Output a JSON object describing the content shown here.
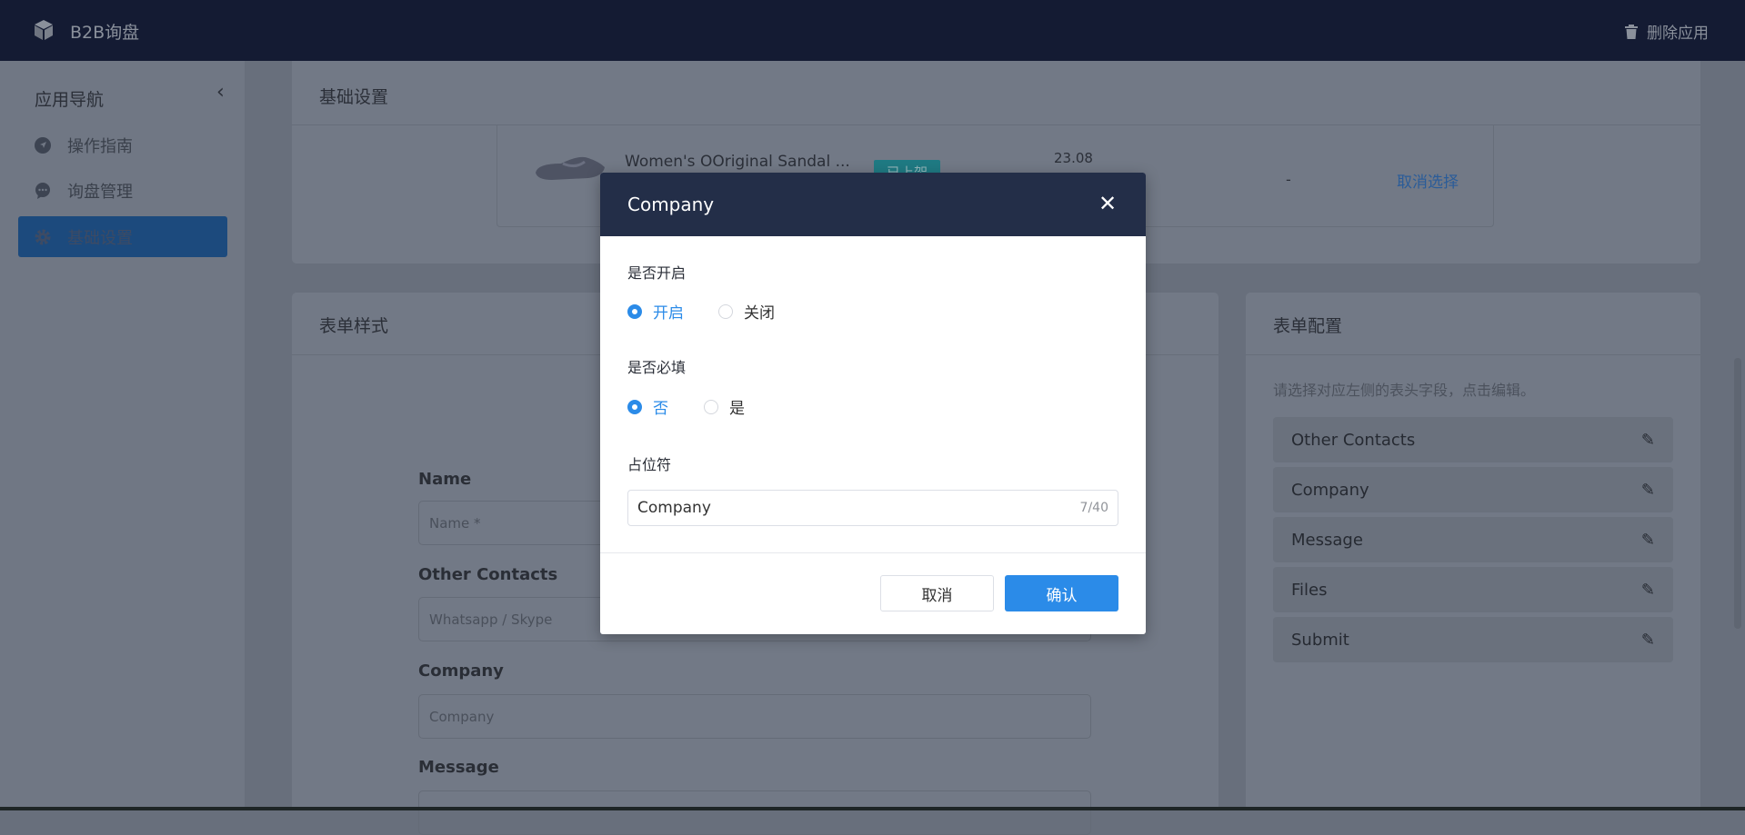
{
  "header": {
    "app_title": "B2B询盘",
    "delete_label": "删除应用"
  },
  "sidebar": {
    "title": "应用导航",
    "items": [
      {
        "label": "操作指南",
        "icon": "navigation-icon"
      },
      {
        "label": "询盘管理",
        "icon": "chat-icon"
      },
      {
        "label": "基础设置",
        "icon": "gear-icon",
        "active": true
      }
    ]
  },
  "basic": {
    "title": "基础设置",
    "product": {
      "name": "Women's OOriginal Sandal ...",
      "status": "已上架",
      "price": "23.08",
      "extra": "-",
      "action": "取消选择"
    }
  },
  "form_style": {
    "title": "表单样式",
    "fields": [
      {
        "label": "Name",
        "placeholder": "Name *"
      },
      {
        "label": "Other Contacts",
        "placeholder": "Whatsapp / Skype"
      },
      {
        "label": "Company",
        "placeholder": "Company"
      },
      {
        "label": "Message",
        "placeholder": ""
      }
    ]
  },
  "form_config": {
    "title": "表单配置",
    "hint": "请选择对应左侧的表头字段，点击编辑。",
    "items": [
      "Other Contacts",
      "Company",
      "Message",
      "Files",
      "Submit"
    ]
  },
  "modal": {
    "title": "Company",
    "enable": {
      "label": "是否开启",
      "options": [
        "开启",
        "关闭"
      ],
      "selected": "开启"
    },
    "required": {
      "label": "是否必填",
      "options": [
        "否",
        "是"
      ],
      "selected": "否"
    },
    "placeholder": {
      "label": "占位符",
      "value": "Company",
      "count": "7/40"
    },
    "cancel": "取消",
    "confirm": "确认"
  },
  "colors": {
    "header": "#141b33",
    "modal_header": "#232e48",
    "primary": "#2b8be8"
  }
}
